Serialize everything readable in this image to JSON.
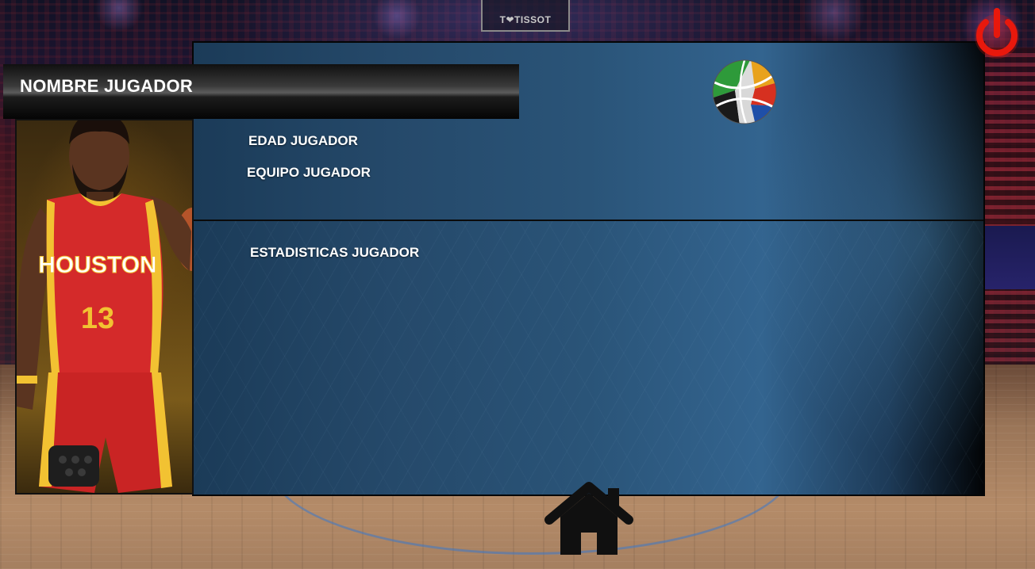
{
  "arena": {
    "scoreboard_text": "T❤TISSOT"
  },
  "player": {
    "name_label": "NOMBRE JUGADOR",
    "age_label": "EDAD JUGADOR",
    "team_label": "EQUIPO JUGADOR",
    "stats_label": "ESTADISTICAS JUGADOR",
    "jersey_text": "HOUSTON",
    "jersey_number": "13"
  },
  "icons": {
    "power": "power-icon",
    "home": "home-icon",
    "logo": "basketball-logo-icon"
  },
  "colors": {
    "power_red": "#e8180c",
    "jersey_red": "#d42a2a",
    "jersey_gold": "#f2c232",
    "panel_blue": "#2a5478"
  }
}
